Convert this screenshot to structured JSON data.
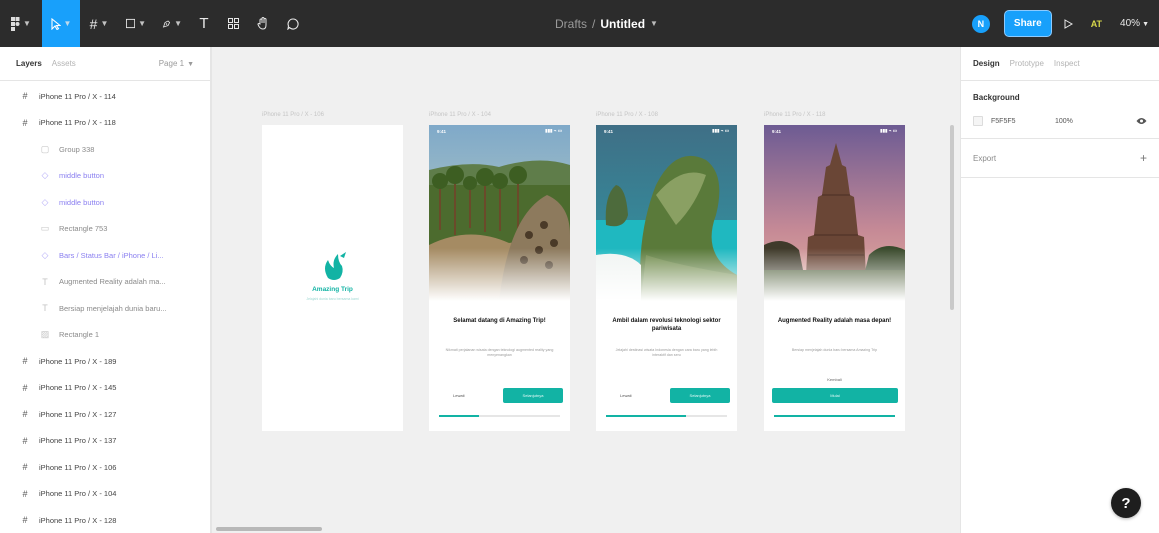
{
  "toolbar": {
    "file_path_parent": "Drafts",
    "file_path_separator": "/",
    "file_name": "Untitled",
    "avatar_initial": "N",
    "share_label": "Share",
    "ai_badge": "AT",
    "zoom": "40%"
  },
  "left_panel": {
    "tabs": [
      {
        "label": "Layers"
      },
      {
        "label": "Assets"
      }
    ],
    "page_selector": "Page 1",
    "layers": [
      {
        "label": "iPhone 11 Pro / X - 114",
        "icon": "frame-icon",
        "level": 0
      },
      {
        "label": "iPhone 11 Pro / X - 118",
        "icon": "frame-icon",
        "level": 0
      },
      {
        "label": "Group 338",
        "icon": "group-icon",
        "level": 1
      },
      {
        "label": "middle button",
        "icon": "component-icon",
        "level": 1
      },
      {
        "label": "middle button",
        "icon": "component-icon",
        "level": 1
      },
      {
        "label": "Rectangle 753",
        "icon": "rectangle-icon",
        "level": 1
      },
      {
        "label": "Bars / Status Bar / iPhone / Li...",
        "icon": "component-icon",
        "level": 1
      },
      {
        "label": "Augmented Reality adalah ma...",
        "icon": "text-icon",
        "level": 1
      },
      {
        "label": "Bersiap menjelajah dunia baru...",
        "icon": "text-icon",
        "level": 1
      },
      {
        "label": "Rectangle 1",
        "icon": "image-icon",
        "level": 1
      },
      {
        "label": "iPhone 11 Pro / X - 189",
        "icon": "frame-icon",
        "level": 0
      },
      {
        "label": "iPhone 11 Pro / X - 145",
        "icon": "frame-icon",
        "level": 0
      },
      {
        "label": "iPhone 11 Pro / X - 127",
        "icon": "frame-icon",
        "level": 0
      },
      {
        "label": "iPhone 11 Pro / X - 137",
        "icon": "frame-icon",
        "level": 0
      },
      {
        "label": "iPhone 11 Pro / X - 106",
        "icon": "frame-icon",
        "level": 0
      },
      {
        "label": "iPhone 11 Pro / X - 104",
        "icon": "frame-icon",
        "level": 0
      },
      {
        "label": "iPhone 11 Pro / X - 128",
        "icon": "frame-icon",
        "level": 0
      }
    ]
  },
  "canvas": {
    "frames": [
      {
        "label": "iPhone 11 Pro / X - 106",
        "app_title": "Amazing Trip",
        "app_subtitle": "Jelajahi dunia baru bersama kami"
      },
      {
        "label": "iPhone 11 Pro / X - 104",
        "status_time": "9:41",
        "status_icons": "▮▮▮ ⌁ ▭",
        "title": "Selamat datang di Amazing Trip!",
        "body": "Nikmati perjalanan wisata dengan teknologi augmented reality yang menyenangkan",
        "skip_label": "Lewati",
        "cta_label": "Selanjutnya",
        "progress": 0.33
      },
      {
        "label": "iPhone 11 Pro / X - 108",
        "status_time": "9:41",
        "status_icons": "▮▮▮ ⌁ ▭",
        "title": "Ambil dalam revolusi teknologi sektor pariwisata",
        "body": "Jelajahi destinasi wisata Indonesia dengan cara baru yang lebih interaktif dan seru",
        "skip_label": "Lewati",
        "cta_label": "Selanjutnya",
        "progress": 0.66
      },
      {
        "label": "iPhone 11 Pro / X - 118",
        "status_time": "9:41",
        "status_icons": "▮▮▮ ⌁ ▭",
        "title": "Augmented Reality adalah masa depan!",
        "body": "Bersiap menjelajah dunia baru bersama Amazing Trip",
        "back_label": "Kembali",
        "cta_label": "Mulai",
        "progress": 1.0
      }
    ]
  },
  "right_panel": {
    "tabs": [
      {
        "label": "Design"
      },
      {
        "label": "Prototype"
      },
      {
        "label": "Inspect"
      }
    ],
    "background_heading": "Background",
    "background_hex": "F5F5F5",
    "background_opacity": "100%",
    "export_label": "Export"
  },
  "colors": {
    "toolbar_bg": "#2c2c2c",
    "accent_blue": "#18a0fb",
    "teal": "#12b3a4",
    "canvas_bg": "#f0f0f0"
  }
}
